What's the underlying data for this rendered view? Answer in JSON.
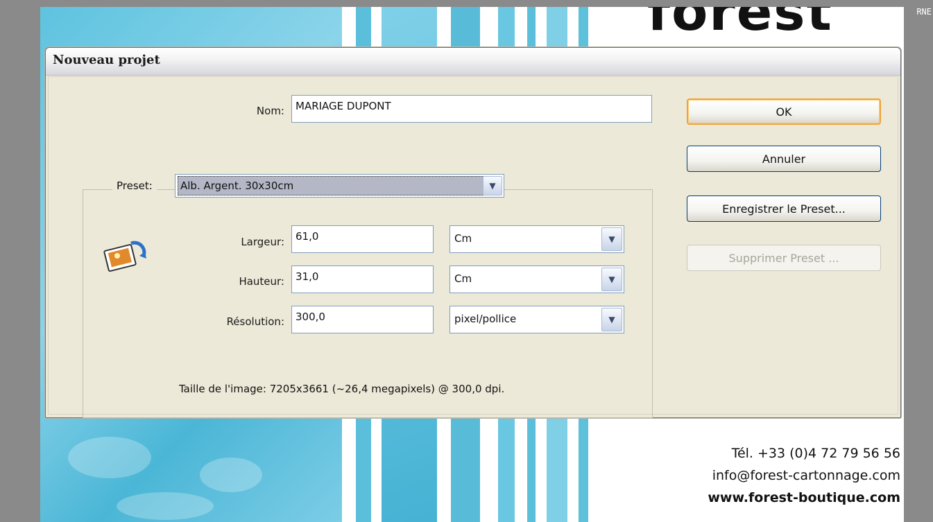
{
  "background": {
    "logo_text": "forest",
    "corner_text": "RNE",
    "contact": {
      "tel": "Tél. +33 (0)4 72 79 56 56",
      "email": "info@forest-cartonnage.com",
      "web": "www.forest-boutique.com"
    }
  },
  "dialog": {
    "title": "Nouveau projet",
    "name": {
      "label": "Nom:",
      "value": "MARIAGE DUPONT"
    },
    "preset": {
      "label": "Preset:",
      "selected": "Alb. Argent. 30x30cm"
    },
    "width": {
      "label": "Largeur:",
      "value": "61,0",
      "unit": "Cm"
    },
    "height": {
      "label": "Hauteur:",
      "value": "31,0",
      "unit": "Cm"
    },
    "resolution": {
      "label": "Résolution:",
      "value": "300,0",
      "unit": "pixel/pollice"
    },
    "image_size": "Taille de l'image: 7205x3661 (~26,4 megapixels) @ 300,0 dpi.",
    "buttons": {
      "ok": "OK",
      "cancel": "Annuler",
      "save_preset": "Enregistrer le Preset...",
      "delete_preset": "Supprimer Preset ..."
    },
    "icon": "image-resize-icon"
  },
  "colors": {
    "accent_blue": "#5ec3df",
    "default_button_border": "#f0a33a",
    "selection": "#b3b7c6"
  }
}
